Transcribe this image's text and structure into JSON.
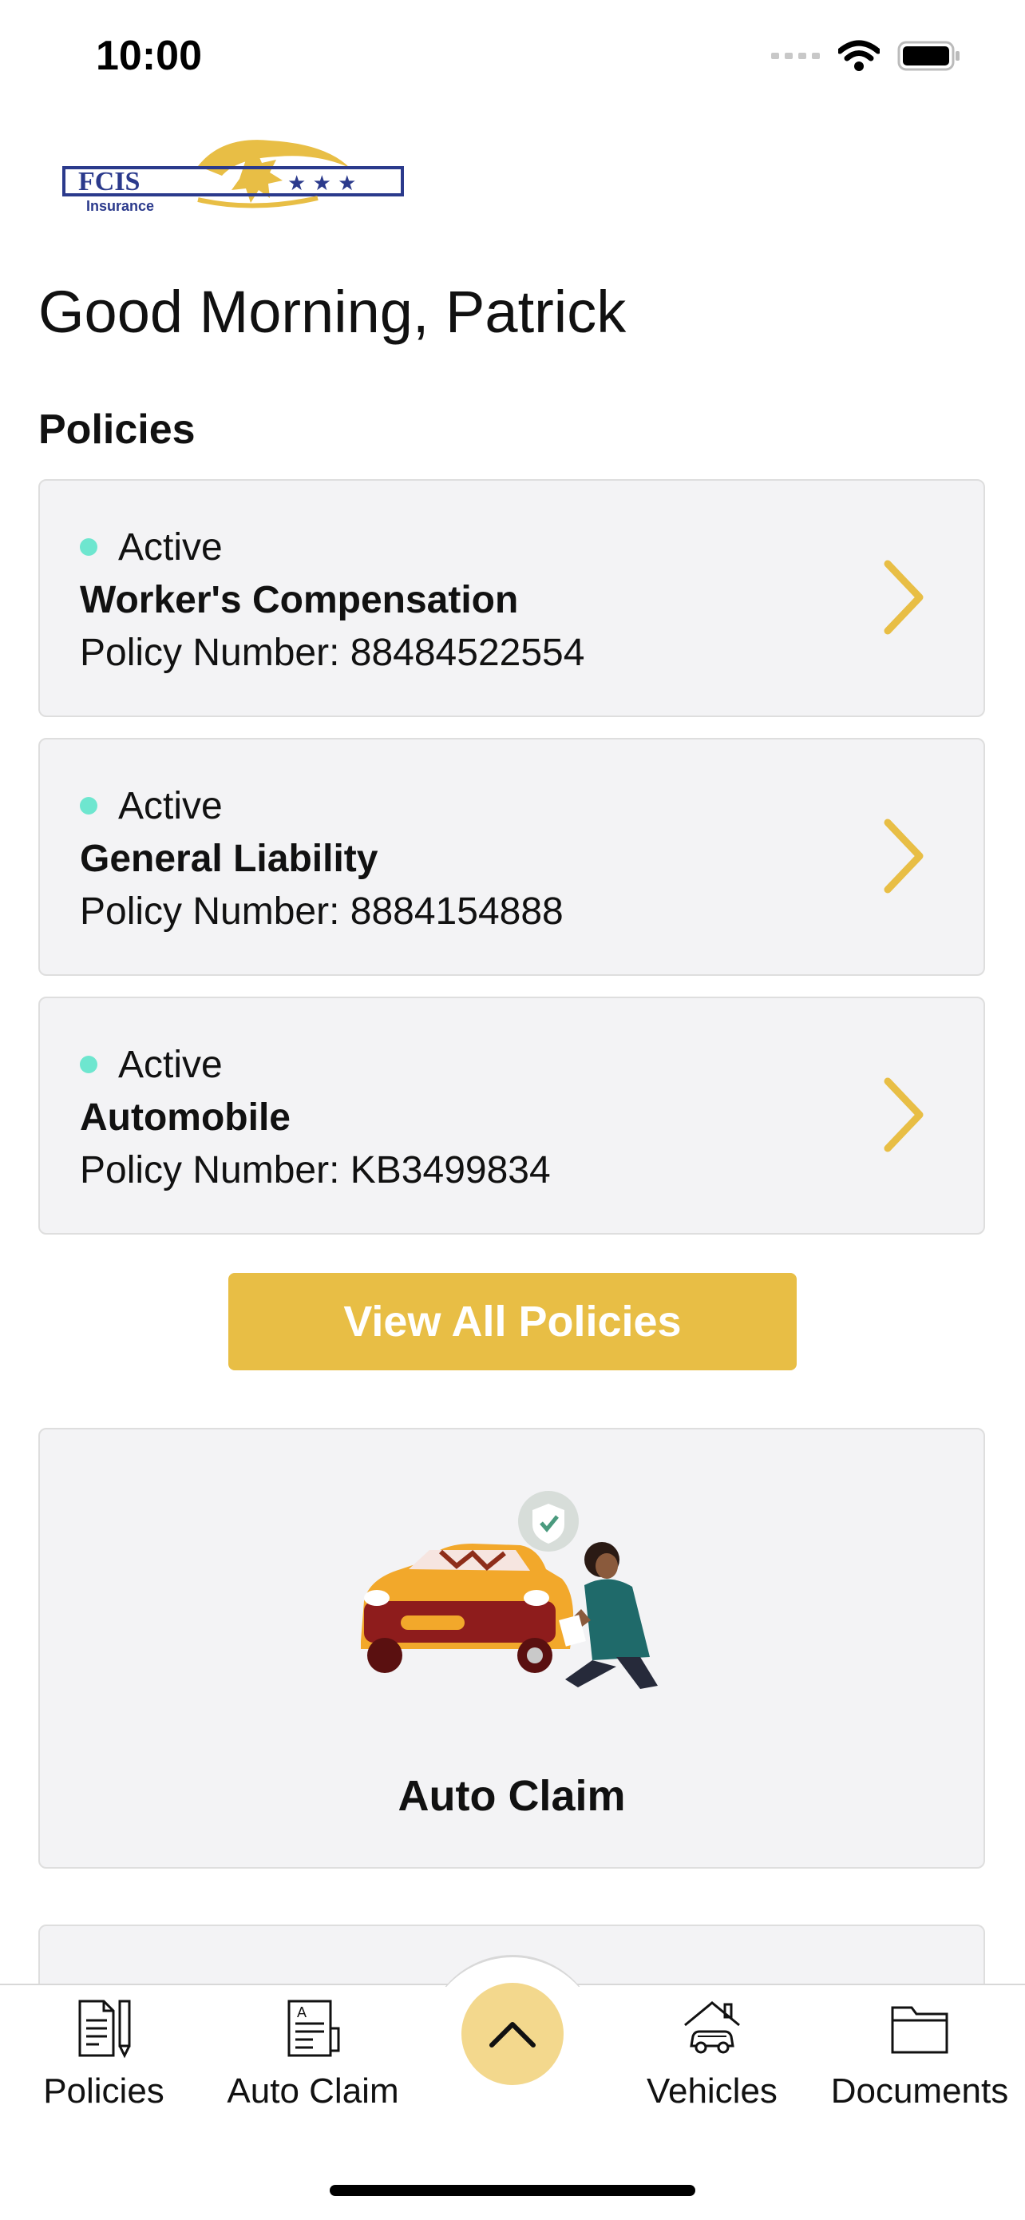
{
  "status_bar": {
    "time": "10:00",
    "icons": [
      "signal-icon",
      "wifi-icon",
      "battery-icon"
    ]
  },
  "logo": {
    "wordmark": "FCIS",
    "subtitle": "Insurance",
    "brand_color": "#e8be45",
    "mark_color": "#2b3a8c"
  },
  "greeting": "Good Morning, Patrick",
  "policies_section": {
    "title": "Policies",
    "items": [
      {
        "status": "Active",
        "name": "Worker's Compensation",
        "number": "Policy Number: 88484522554"
      },
      {
        "status": "Active",
        "name": "General Liability",
        "number": "Policy Number: 8884154888"
      },
      {
        "status": "Active",
        "name": "Automobile",
        "number": "Policy Number: KB3499834"
      }
    ],
    "view_all_label": "View All Policies"
  },
  "claim_card": {
    "label": "Auto Claim",
    "illustration": "car-damage-illustration"
  },
  "tab_bar": {
    "items": [
      {
        "label": "Policies",
        "icon": "policy-document-icon"
      },
      {
        "label": "Auto Claim",
        "icon": "claim-form-icon"
      },
      {
        "label": "Vehicles",
        "icon": "garage-car-icon"
      },
      {
        "label": "Documents",
        "icon": "folder-icon"
      }
    ],
    "center_button_icon": "chevron-up-icon"
  },
  "colors": {
    "accent": "#e8be45",
    "accent_light": "#f3d88d",
    "status_active": "#6ee6cf",
    "card_bg": "#f3f3f5"
  }
}
